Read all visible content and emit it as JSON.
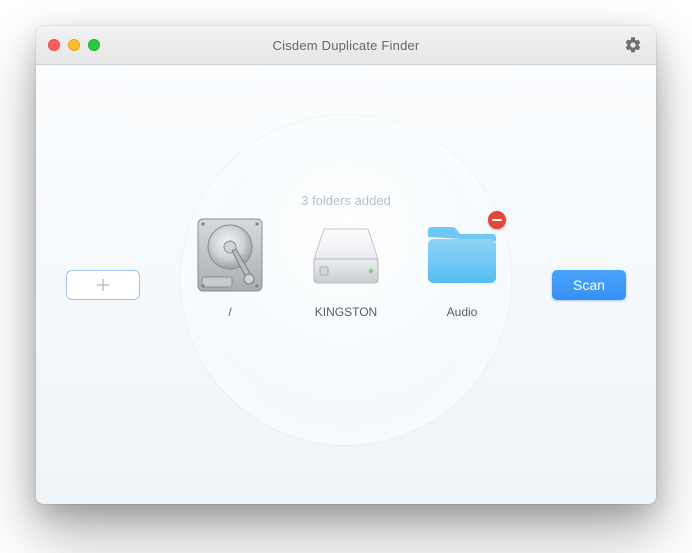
{
  "window": {
    "title": "Cisdem Duplicate Finder"
  },
  "status": {
    "folders_added_label": "3 folders added"
  },
  "buttons": {
    "scan_label": "Scan"
  },
  "items": [
    {
      "label": "/"
    },
    {
      "label": "KINGSTON"
    },
    {
      "label": "Audio"
    }
  ]
}
